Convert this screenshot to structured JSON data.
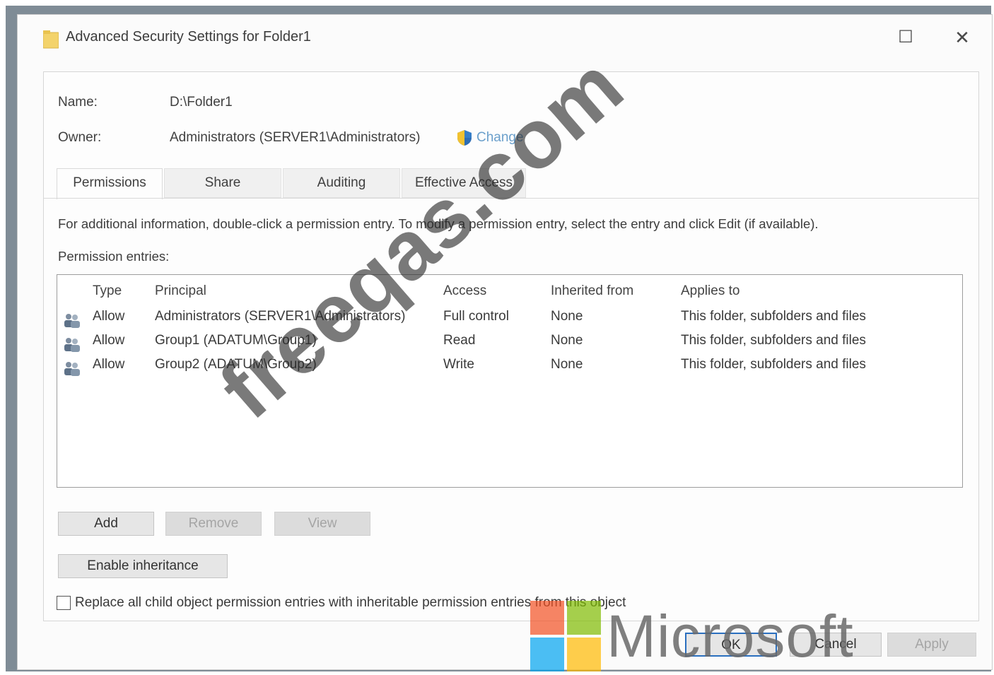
{
  "window": {
    "title": "Advanced Security Settings for Folder1",
    "maximize_glyph": "☐",
    "close_glyph": "✕"
  },
  "info": {
    "name_label": "Name:",
    "name_value": "D:\\Folder1",
    "owner_label": "Owner:",
    "owner_value": "Administrators (SERVER1\\Administrators)",
    "change_link": "Change"
  },
  "tabs": [
    {
      "label": "Permissions",
      "active": true
    },
    {
      "label": "Share",
      "active": false
    },
    {
      "label": "Auditing",
      "active": false
    },
    {
      "label": "Effective Access",
      "active": false
    }
  ],
  "instructions": "For additional information, double-click a permission entry. To modify a permission entry, select the entry and click Edit (if available).",
  "entries_label": "Permission entries:",
  "table": {
    "columns": [
      "Type",
      "Principal",
      "Access",
      "Inherited from",
      "Applies to"
    ],
    "rows": [
      {
        "type": "Allow",
        "principal": "Administrators (SERVER1\\Administrators)",
        "access": "Full control",
        "inherited": "None",
        "applies": "This folder, subfolders and files"
      },
      {
        "type": "Allow",
        "principal": "Group1 (ADATUM\\Group1)",
        "access": "Read",
        "inherited": "None",
        "applies": "This folder, subfolders and files"
      },
      {
        "type": "Allow",
        "principal": "Group2 (ADATUM\\Group2)",
        "access": "Write",
        "inherited": "None",
        "applies": "This folder, subfolders and files"
      }
    ]
  },
  "buttons": {
    "add": "Add",
    "remove": "Remove",
    "view": "View",
    "enable_inheritance": "Enable inheritance",
    "ok": "OK",
    "cancel": "Cancel",
    "apply": "Apply"
  },
  "replace_checkbox": {
    "label": "Replace all child object permission entries with inheritable permission entries from this object",
    "checked": false
  },
  "watermarks": {
    "site": "freeqas.com",
    "brand": "Microsoft"
  },
  "colors": {
    "link": "#6a9fcb",
    "ms_red": "#f25022",
    "ms_green": "#7fba00",
    "ms_blue": "#00a4ef",
    "ms_yellow": "#ffb900"
  }
}
